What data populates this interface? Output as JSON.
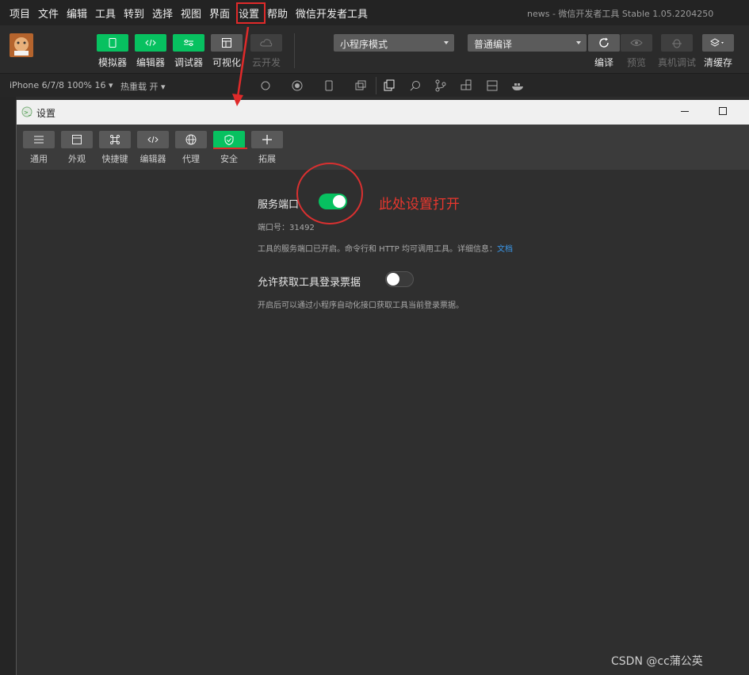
{
  "menu": {
    "items": [
      "项目",
      "文件",
      "编辑",
      "工具",
      "转到",
      "选择",
      "视图",
      "界面",
      "设置",
      "帮助",
      "微信开发者工具"
    ],
    "window_title": "news - 微信开发者工具 Stable 1.05.2204250"
  },
  "toolbar": {
    "left_buttons": [
      {
        "label": "模拟器",
        "icon": "phone-icon"
      },
      {
        "label": "编辑器",
        "icon": "code-icon"
      },
      {
        "label": "调试器",
        "icon": "debug-icon"
      },
      {
        "label": "可视化",
        "icon": "layout-icon"
      },
      {
        "label": "云开发",
        "icon": "cloud-icon"
      }
    ],
    "mode_dropdown": "小程序模式",
    "compile_dropdown": "普通编译",
    "right_buttons": [
      {
        "label": "编译",
        "icon": "refresh-icon"
      },
      {
        "label": "预览",
        "icon": "eye-icon"
      },
      {
        "label": "真机调试",
        "icon": "bug-icon"
      },
      {
        "label": "清缓存",
        "icon": "layers-icon"
      }
    ]
  },
  "subbar": {
    "device": "iPhone 6/7/8 100% 16",
    "hot_reload": "热重载 开"
  },
  "settings": {
    "title": "设置",
    "tabs": [
      {
        "label": "通用",
        "icon": "sliders-icon"
      },
      {
        "label": "外观",
        "icon": "window-icon"
      },
      {
        "label": "快捷键",
        "icon": "command-icon"
      },
      {
        "label": "编辑器",
        "icon": "code-icon"
      },
      {
        "label": "代理",
        "icon": "globe-icon"
      },
      {
        "label": "安全",
        "icon": "shield-icon"
      },
      {
        "label": "拓展",
        "icon": "plus-icon"
      }
    ],
    "active_tab": "安全",
    "service_port": {
      "label": "服务端口",
      "enabled": true,
      "port_text": "端口号：31492",
      "desc": "工具的服务端口已开启。命令行和 HTTP 均可调用工具。详细信息：",
      "link": "文档"
    },
    "login_ticket": {
      "label": "允许获取工具登录票据",
      "enabled": false,
      "desc": "开启后可以通过小程序自动化接口获取工具当前登录票据。"
    }
  },
  "annotation": "此处设置打开",
  "watermark": "CSDN @cc蒲公英",
  "colors": {
    "accent": "#07c160",
    "annotation": "#e8372e",
    "link": "#3a97e8"
  }
}
